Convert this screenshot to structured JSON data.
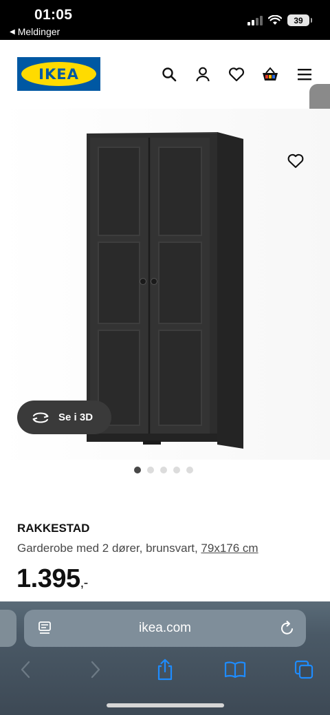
{
  "status_bar": {
    "time": "01:05",
    "back_label": "Meldinger",
    "battery": "39"
  },
  "header": {
    "logo_text": "IKEA",
    "icons": [
      "search-icon",
      "user-icon",
      "heart-icon",
      "basket-icon",
      "menu-icon"
    ]
  },
  "product": {
    "view_3d_label": "Se i 3D",
    "image_count": 5,
    "active_image": 1,
    "name": "RAKKESTAD",
    "description": "Garderobe med 2 dører, brunsvart, ",
    "dimensions": "79x176 cm",
    "price": "1.395",
    "price_suffix": ",-"
  },
  "browser": {
    "url": "ikea.com"
  },
  "colors": {
    "ikea_blue": "#0058a3",
    "ikea_yellow": "#ffdb00",
    "wardrobe": "#2b2b2b"
  }
}
